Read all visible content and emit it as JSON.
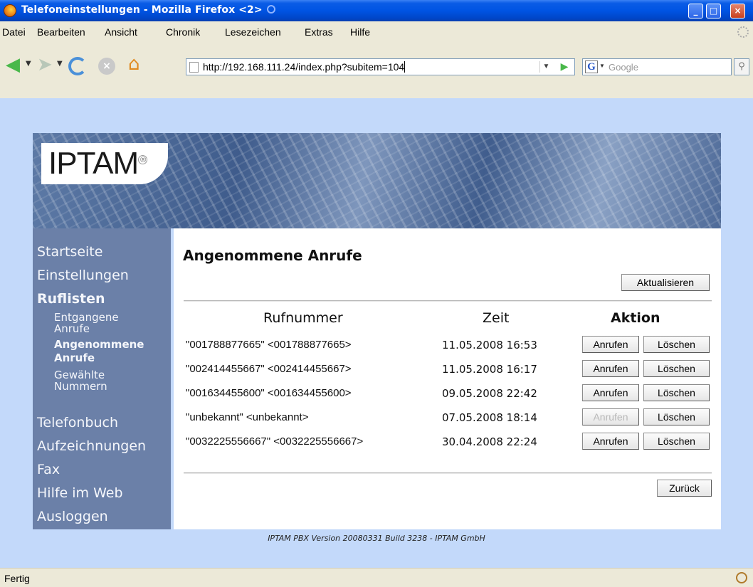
{
  "window": {
    "title": "Telefoneinstellungen - Mozilla Firefox <2>",
    "minimize": "_",
    "maximize": "□",
    "close": "×"
  },
  "menu": {
    "items": [
      "Datei",
      "Bearbeiten",
      "Ansicht",
      "Chronik",
      "Lesezeichen",
      "Extras",
      "Hilfe"
    ]
  },
  "toolbar": {
    "url": "http://192.168.111.24/index.php?subitem=104",
    "search_placeholder": "Google",
    "search_engine_letter": "G"
  },
  "site": {
    "logo": "IPTAM",
    "nav": {
      "main": [
        "Startseite",
        "Einstellungen",
        "Ruflisten",
        "Telefonbuch",
        "Aufzeichnungen",
        "Fax",
        "Hilfe im Web",
        "Ausloggen"
      ],
      "sub": {
        "entgangene": [
          "Entgangene",
          "Anrufe"
        ],
        "angenommene": [
          "Angenommene",
          "Anrufe"
        ],
        "gewaehlte": [
          "Gewählte",
          "Nummern"
        ]
      }
    },
    "page_title": "Angenommene Anrufe",
    "refresh_button": "Aktualisieren",
    "back_button": "Zurück",
    "columns": {
      "number": "Rufnummer",
      "time": "Zeit",
      "action": "Aktion"
    },
    "rows": [
      {
        "number": "\"001788877665\" <001788877665>",
        "time": "11.05.2008 16:53",
        "call": "Anrufen",
        "call_enabled": true,
        "delete": "Löschen"
      },
      {
        "number": "\"002414455667\" <002414455667>",
        "time": "11.05.2008 16:17",
        "call": "Anrufen",
        "call_enabled": true,
        "delete": "Löschen"
      },
      {
        "number": "\"001634455600\" <001634455600>",
        "time": "09.05.2008 22:42",
        "call": "Anrufen",
        "call_enabled": true,
        "delete": "Löschen"
      },
      {
        "number": "\"unbekannt\" <unbekannt>",
        "time": "07.05.2008 18:14",
        "call": "Anrufen",
        "call_enabled": false,
        "delete": "Löschen"
      },
      {
        "number": "\"0032225556667\" <0032225556667>",
        "time": "30.04.2008 22:24",
        "call": "Anrufen",
        "call_enabled": true,
        "delete": "Löschen"
      }
    ],
    "footer": "IPTAM PBX Version 20080331 Build 3238 - IPTAM GmbH"
  },
  "status": {
    "text": "Fertig"
  }
}
